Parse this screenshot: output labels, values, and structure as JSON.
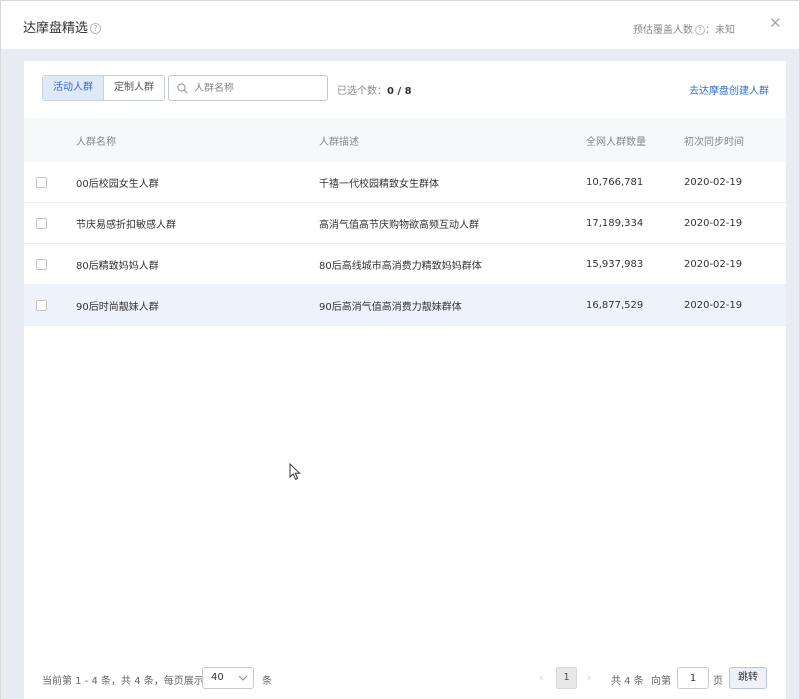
{
  "dialog": {
    "title": "达摩盘精选",
    "coverage_label": "预估覆盖人数",
    "coverage_value": "：未知",
    "close_symbol": "✕"
  },
  "toolbar": {
    "tabs": [
      {
        "label": "活动人群",
        "active": true
      },
      {
        "label": "定制人群",
        "active": false
      }
    ],
    "search_placeholder": "人群名称",
    "selected_label": "已选个数：",
    "selected_value": "0 / 8",
    "create_link": "去达摩盘创建人群"
  },
  "table": {
    "headers": [
      "人群名称",
      "人群描述",
      "全网人群数量",
      "初次同步时间"
    ],
    "rows": [
      {
        "name": "00后校园女生人群",
        "desc": "千禧一代校园精致女生群体",
        "count": "10,766,781",
        "date": "2020-02-19"
      },
      {
        "name": "节庆易感折扣敏感人群",
        "desc": "高消气值高节庆购物欲高频互动人群",
        "count": "17,189,334",
        "date": "2020-02-19"
      },
      {
        "name": "80后精致妈妈人群",
        "desc": "80后高线城市高消费力精致妈妈群体",
        "count": "15,937,983",
        "date": "2020-02-19"
      },
      {
        "name": "90后时尚靓妹人群",
        "desc": "90后高消气值高消费力靓妹群体",
        "count": "16,877,529",
        "date": "2020-02-19"
      }
    ]
  },
  "pagination": {
    "range_text": "当前第 1 - 4 条，共 4 条，每页展示",
    "page_size": "40",
    "unit": "条",
    "current_page": "1",
    "total_text": "共 4 条",
    "goto_label": "向第",
    "goto_value": "1",
    "page_unit": "页",
    "jump_label": "跳转"
  },
  "colors": {
    "accent": "#2f6fd1",
    "backdrop": "#e9edf3",
    "hover_row": "#edf2fb"
  }
}
